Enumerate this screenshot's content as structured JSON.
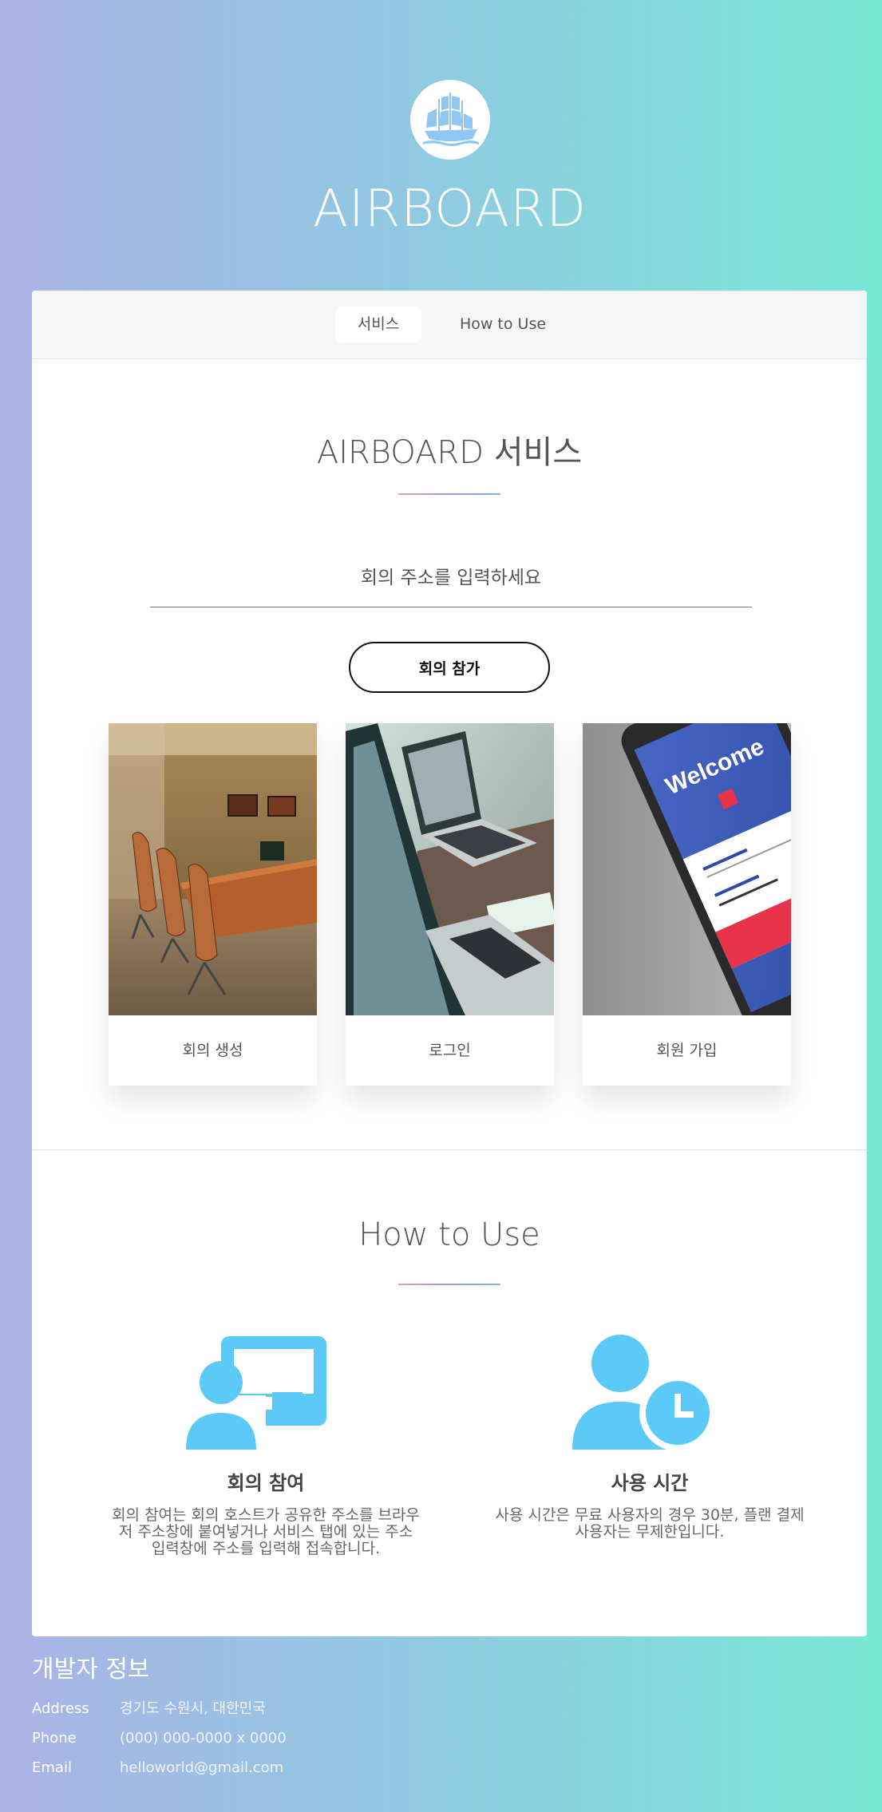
{
  "header": {
    "logo_icon": "ship-icon",
    "site_title": "AIRBOARD"
  },
  "nav": {
    "tabs": [
      {
        "label": "서비스",
        "active": true
      },
      {
        "label": "How to Use",
        "active": false
      }
    ]
  },
  "service": {
    "title": "AIRBOARD 서비스",
    "input_placeholder": "회의 주소를 입력하세요",
    "join_button": "회의 참가",
    "tiles": [
      {
        "label": "회의 생성",
        "image": "conference-room-photo"
      },
      {
        "label": "로그인",
        "image": "laptop-photo"
      },
      {
        "label": "회원 가입",
        "image": "phone-welcome-photo",
        "image_text": "Welcome"
      }
    ]
  },
  "how_to_use": {
    "title": "How to Use",
    "features": [
      {
        "icon": "presentation-user-icon",
        "title": "회의 참여",
        "desc_lines": [
          "회의 참여는 회의 호스트가 공유한 주소를 브라우",
          "저 주소창에 붙여넣거나 서비스 탭에 있는 주소",
          "입력창에 주소를 입력해 접속합니다."
        ]
      },
      {
        "icon": "user-clock-icon",
        "title": "사용 시간",
        "desc_lines": [
          "사용 시간은 무료 사용자의 경우 30분, 플랜 결제",
          "사용자는 무제한입니다."
        ]
      }
    ]
  },
  "footer": {
    "title": "개발자 정보",
    "rows": [
      {
        "key": "Address",
        "value": "경기도 수원시, 대한민국"
      },
      {
        "key": "Phone",
        "value": "(000) 000-0000 x 0000"
      },
      {
        "key": "Email",
        "value": "helloworld@gmail.com"
      }
    ]
  },
  "colors": {
    "icon_blue": "#5bcaf9",
    "gradient_left": "#aab3e6",
    "gradient_right": "#79e8d6",
    "underline_pink": "#e59cb5",
    "underline_blue": "#7cb6e2"
  }
}
